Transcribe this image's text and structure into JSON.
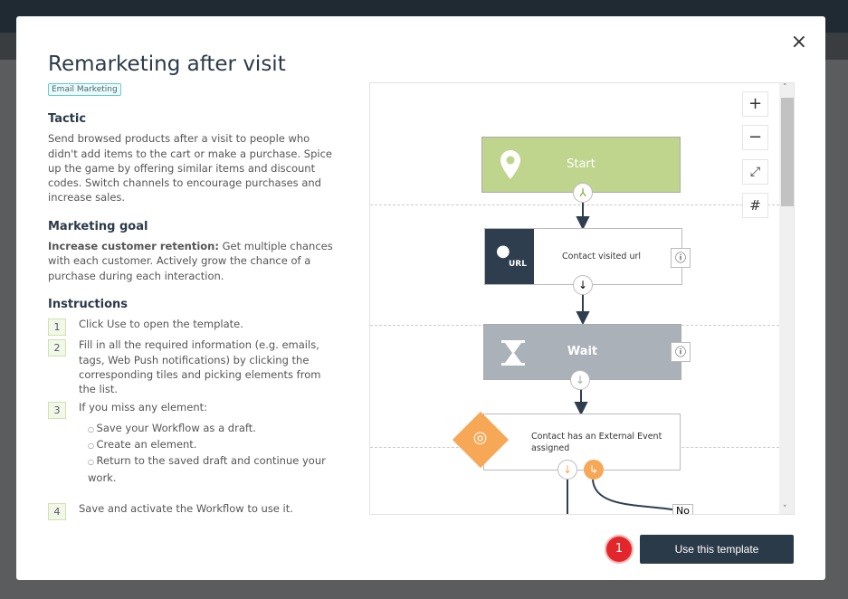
{
  "title": "Remarketing after visit",
  "tag": "Email Marketing",
  "tactic": {
    "heading": "Tactic",
    "text": "Send browsed products after a visit to people who didn't add items to the cart or make a purchase. Spice up the game by offering similar items and discount codes. Switch channels to encourage purchases and increase sales."
  },
  "goal": {
    "heading": "Marketing goal",
    "bold": "Increase customer retention:",
    "text": " Get multiple chances with each customer. Actively grow the chance of a purchase during each interaction."
  },
  "instructions": {
    "heading": "Instructions",
    "steps": [
      {
        "num": "1",
        "text": "Click Use to open the template."
      },
      {
        "num": "2",
        "text": "Fill in all the required information (e.g. emails, tags, Web Push notifications) by clicking the corresponding tiles and picking elements from the list."
      },
      {
        "num": "3",
        "text": "If you miss any element:",
        "sub": [
          "Save your Workflow as a draft.",
          "Create an element.",
          "Return to the saved draft and continue your work."
        ]
      },
      {
        "num": "4",
        "text": "Save and activate the Workflow to use it."
      }
    ]
  },
  "workflow": {
    "start": "Start",
    "visited": "Contact visited url",
    "url_icon_label": "URL",
    "wait": "Wait",
    "external": "Contact has an External Event assigned",
    "no_label": "No"
  },
  "colors": {
    "start": "#bfd48c",
    "dark": "#2f3e4e",
    "wait": "#abb1b8",
    "orange": "#f7a857",
    "button": "#2b3a48",
    "badge": "#e3262b"
  },
  "button": {
    "use": "Use this template",
    "badge": "1"
  },
  "close": "×"
}
